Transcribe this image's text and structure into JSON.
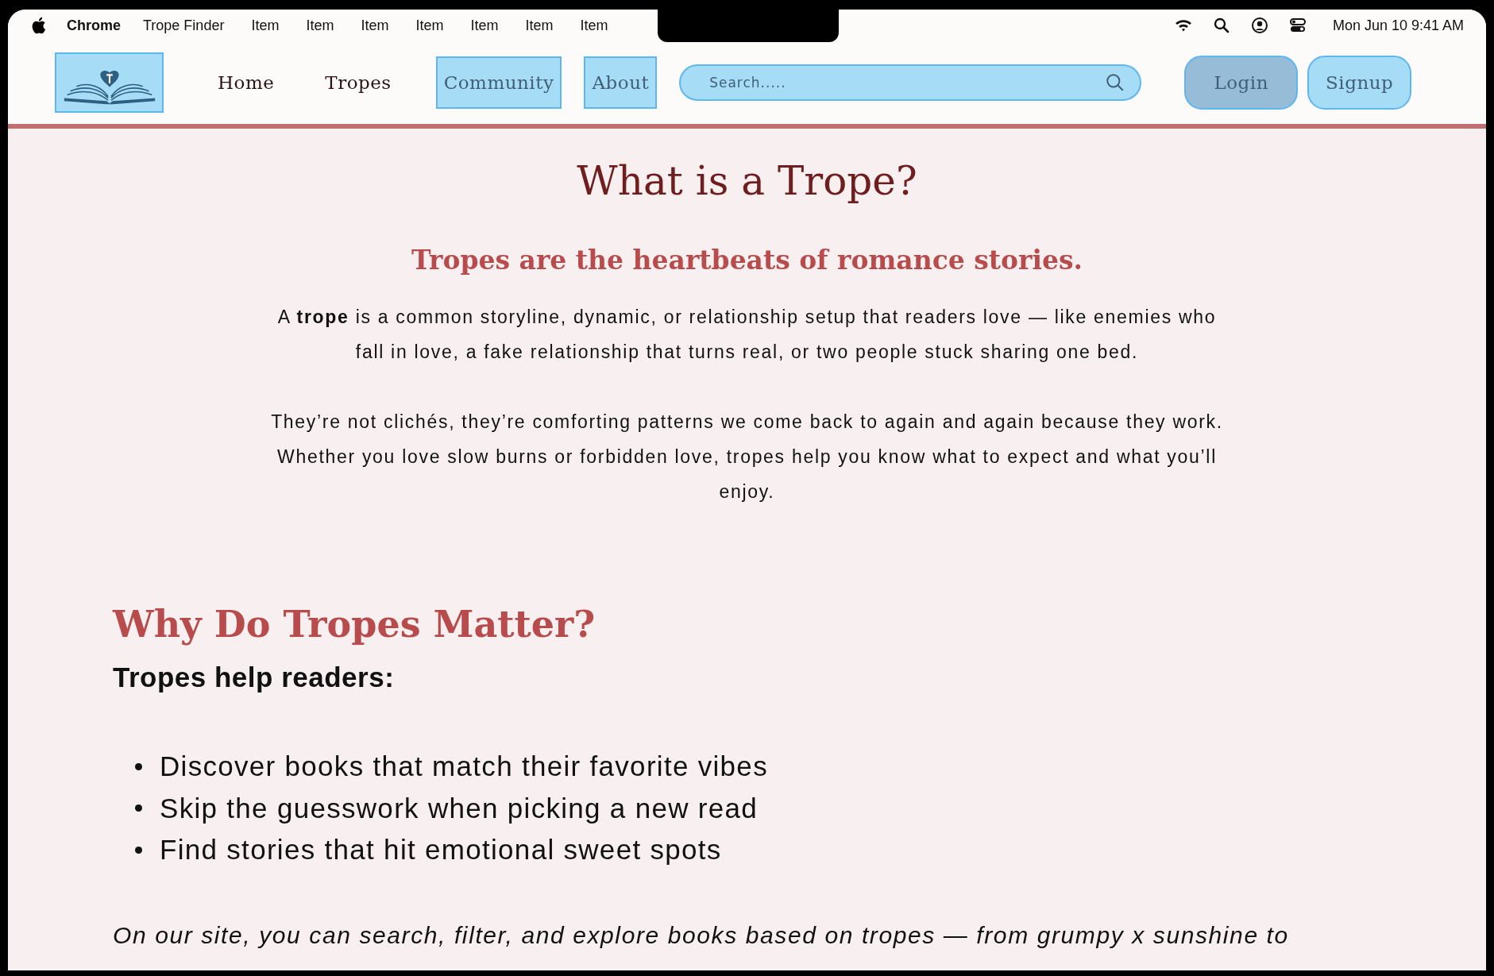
{
  "menu_bar": {
    "app": "Chrome",
    "items": [
      "Trope Finder",
      "Item",
      "Item",
      "Item",
      "Item",
      "Item",
      "Item",
      "Item"
    ],
    "clock": "Mon Jun 10  9:41 AM"
  },
  "nav": {
    "links": [
      {
        "label": "Home",
        "highlighted": false
      },
      {
        "label": "Tropes",
        "highlighted": false
      },
      {
        "label": "Community",
        "highlighted": true
      },
      {
        "label": "About",
        "highlighted": true
      }
    ],
    "search": {
      "placeholder": "Search....."
    },
    "buttons": [
      {
        "label": "Login",
        "kind": "filled"
      },
      {
        "label": "Signup",
        "kind": "outline"
      }
    ]
  },
  "intro": {
    "title": "What is a Trope?",
    "subtitle": "Tropes are the heartbeats of romance stories.",
    "paragraphs": [
      "A **trope** is a common storyline, dynamic, or relationship setup that readers love — like enemies who fall in love, a fake relationship that turns real, or two people stuck sharing one bed.",
      "They’re not clichés, they’re comforting patterns we come back to again and again because they work. Whether you love slow burns or forbidden love, tropes help you know what to expect and what you’ll enjoy."
    ]
  },
  "why": {
    "heading": "Why Do Tropes Matter?",
    "lead": "Tropes help readers:",
    "bullets": [
      "Discover books that match their favorite vibes",
      "Skip the guesswork when picking a new read",
      "Find stories that hit emotional sweet spots"
    ],
    "closing": "On our site, you can search, filter, and explore books based on tropes — from grumpy x sunshine to"
  }
}
